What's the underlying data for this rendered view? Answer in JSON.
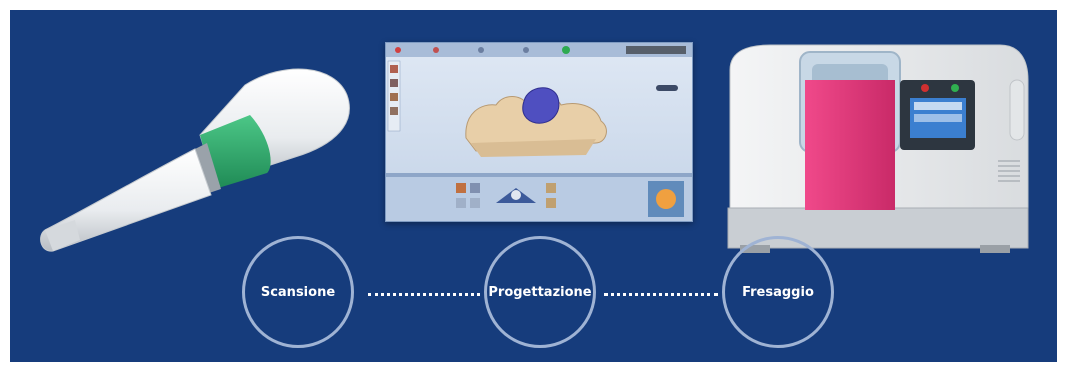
{
  "colors": {
    "background": "#163c7c",
    "circle_border": "#9fb3d4",
    "label_text": "#ffffff",
    "scanner_tip": "#2aa46a",
    "mill_accent": "#e23a7c"
  },
  "images": {
    "scanner": "intraoral-scanner",
    "software": "cad-design-software-screenshot",
    "mill": "milling-machine"
  },
  "steps": [
    {
      "label": "Scansione"
    },
    {
      "label": "Progettazione"
    },
    {
      "label": "Fresaggio"
    }
  ]
}
